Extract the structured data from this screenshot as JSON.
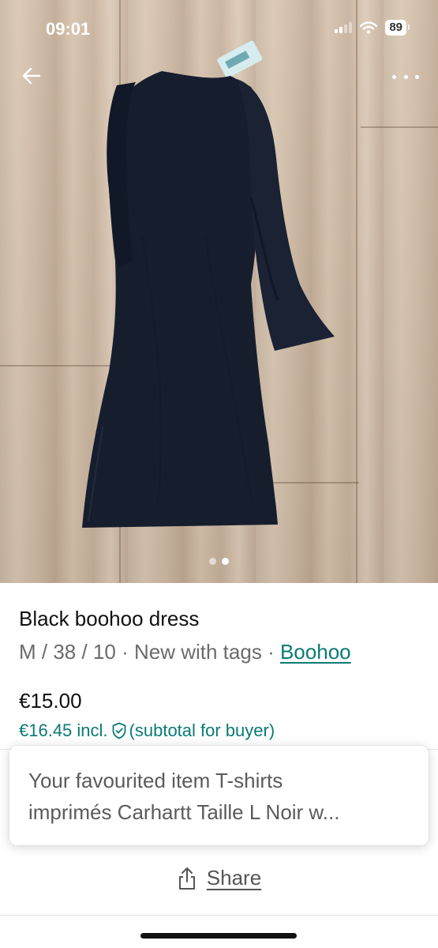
{
  "status_bar": {
    "time": "09:01",
    "battery": "89"
  },
  "photo": {
    "page_index": 2,
    "page_count": 2
  },
  "item": {
    "title": "Black boohoo dress",
    "size": "M / 38 / 10",
    "condition": "New with tags",
    "separator": "·",
    "brand": "Boohoo",
    "price": "€15.00",
    "price_incl": "€16.45 incl.",
    "price_incl_note": "(subtotal for buyer)"
  },
  "toast": {
    "line1": "Your favourited item T-shirts",
    "line2": "imprimés Carhartt Taille L Noir w..."
  },
  "actions": {
    "share_label": "Share"
  },
  "colors": {
    "accent": "#0b7a75",
    "dress": "#161e2e"
  },
  "icons": {
    "back": "arrow-left-icon",
    "more": "more-horizontal-icon",
    "share": "share-icon",
    "shield": "shield-check-icon"
  }
}
